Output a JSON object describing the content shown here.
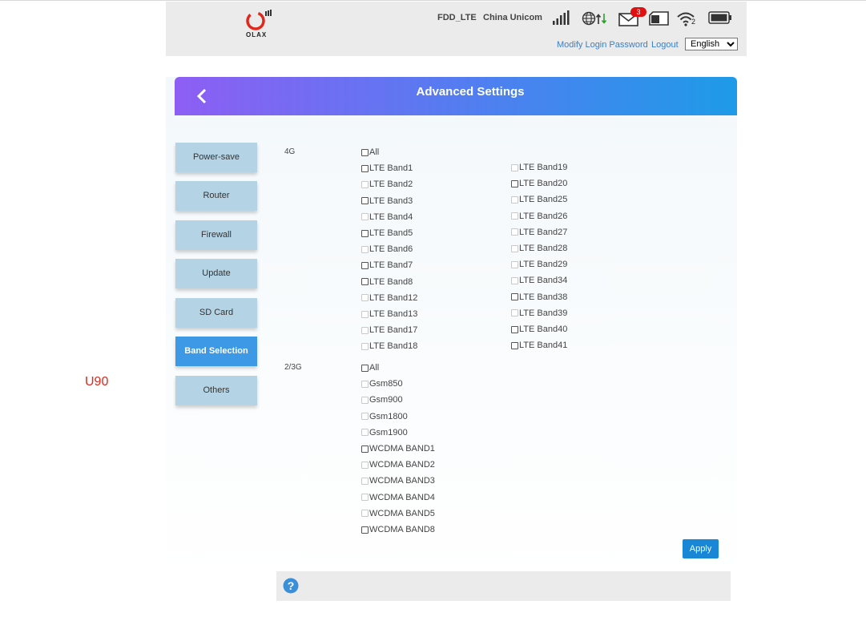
{
  "header": {
    "logo_text": "OLAX",
    "network_type": "FDD_LTE",
    "carrier": "China Unicom",
    "unread_messages": "3",
    "wifi_clients": "2",
    "links": {
      "modify_password": "Modify Login Password",
      "logout": "Logout"
    },
    "language": {
      "selected": "English"
    },
    "icons": [
      "signal-icon",
      "globe-data-icon",
      "mail-icon",
      "sim-icon",
      "wifi-icon",
      "battery-icon"
    ]
  },
  "side_note": "U90",
  "page": {
    "title": "Advanced Settings",
    "menu": [
      {
        "label": "Power-save",
        "active": false
      },
      {
        "label": "Router",
        "active": false
      },
      {
        "label": "Firewall",
        "active": false
      },
      {
        "label": "Update",
        "active": false
      },
      {
        "label": "SD Card",
        "active": false
      },
      {
        "label": "Band Selection",
        "active": true
      },
      {
        "label": "Others",
        "active": false
      }
    ],
    "sections": {
      "lte": {
        "label": "4G",
        "col1": [
          {
            "label": "All",
            "enabled": true
          },
          {
            "label": "LTE Band1",
            "enabled": true
          },
          {
            "label": "LTE Band2",
            "enabled": false
          },
          {
            "label": "LTE Band3",
            "enabled": true
          },
          {
            "label": "LTE Band4",
            "enabled": false
          },
          {
            "label": "LTE Band5",
            "enabled": true
          },
          {
            "label": "LTE Band6",
            "enabled": false
          },
          {
            "label": "LTE Band7",
            "enabled": true
          },
          {
            "label": "LTE Band8",
            "enabled": true
          },
          {
            "label": "LTE Band12",
            "enabled": false
          },
          {
            "label": "LTE Band13",
            "enabled": false
          },
          {
            "label": "LTE Band17",
            "enabled": false
          },
          {
            "label": "LTE Band18",
            "enabled": false
          }
        ],
        "col2": [
          {
            "label": "LTE Band19",
            "enabled": false
          },
          {
            "label": "LTE Band20",
            "enabled": true
          },
          {
            "label": "LTE Band25",
            "enabled": false
          },
          {
            "label": "LTE Band26",
            "enabled": false
          },
          {
            "label": "LTE Band27",
            "enabled": false
          },
          {
            "label": "LTE Band28",
            "enabled": false
          },
          {
            "label": "LTE Band29",
            "enabled": false
          },
          {
            "label": "LTE Band34",
            "enabled": false
          },
          {
            "label": "LTE Band38",
            "enabled": true
          },
          {
            "label": "LTE Band39",
            "enabled": false
          },
          {
            "label": "LTE Band40",
            "enabled": true
          },
          {
            "label": "LTE Band41",
            "enabled": true
          }
        ]
      },
      "legacy": {
        "label": "2/3G",
        "col1": [
          {
            "label": "All",
            "enabled": true
          },
          {
            "label": "Gsm850",
            "enabled": false
          },
          {
            "label": "Gsm900",
            "enabled": false
          },
          {
            "label": "Gsm1800",
            "enabled": false
          },
          {
            "label": "Gsm1900",
            "enabled": false
          },
          {
            "label": "WCDMA BAND1",
            "enabled": true
          },
          {
            "label": "WCDMA BAND2",
            "enabled": false
          },
          {
            "label": "WCDMA BAND3",
            "enabled": false
          },
          {
            "label": "WCDMA BAND4",
            "enabled": false
          },
          {
            "label": "WCDMA BAND5",
            "enabled": false
          },
          {
            "label": "WCDMA BAND8",
            "enabled": true
          }
        ]
      }
    },
    "apply_label": "Apply",
    "help_icon": "question-icon"
  }
}
